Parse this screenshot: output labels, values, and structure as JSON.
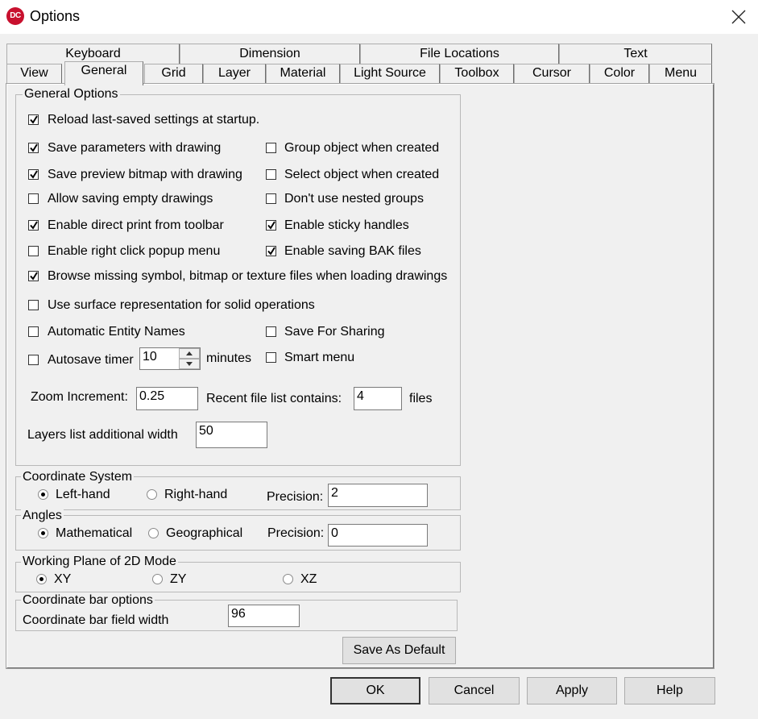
{
  "window": {
    "title": "Options",
    "icon_text": "DC"
  },
  "tabs": {
    "row1": [
      "Keyboard",
      "Dimension",
      "File Locations",
      "Text"
    ],
    "row2": [
      "View",
      "General",
      "Grid",
      "Layer",
      "Material",
      "Light Source",
      "Toolbox",
      "Cursor",
      "Color",
      "Menu"
    ],
    "selected": "General"
  },
  "general_options": {
    "legend": "General Options",
    "reload": {
      "label": "Reload last-saved settings at startup.",
      "checked": true
    },
    "save_params": {
      "label": "Save parameters with drawing",
      "checked": true
    },
    "group_object": {
      "label": "Group object when created",
      "checked": false
    },
    "save_preview": {
      "label": "Save preview bitmap with drawing",
      "checked": true
    },
    "select_object": {
      "label": "Select object when created",
      "checked": false
    },
    "allow_empty": {
      "label": "Allow saving empty drawings",
      "checked": false
    },
    "nested_groups": {
      "label": "Don't use nested groups",
      "checked": false
    },
    "direct_print": {
      "label": "Enable direct print from toolbar",
      "checked": true
    },
    "sticky_handles": {
      "label": "Enable sticky handles",
      "checked": true
    },
    "right_click": {
      "label": "Enable right click popup menu",
      "checked": false
    },
    "bak_files": {
      "label": "Enable saving BAK files",
      "checked": true
    },
    "browse_missing": {
      "label": "Browse missing symbol, bitmap or texture files when loading drawings",
      "checked": true
    },
    "surface_rep": {
      "label": "Use surface representation for solid operations",
      "checked": false
    },
    "auto_names": {
      "label": "Automatic Entity Names",
      "checked": false
    },
    "save_sharing": {
      "label": "Save For Sharing",
      "checked": false
    },
    "autosave": {
      "label": "Autosave timer",
      "checked": false,
      "value": "10",
      "unit": "minutes"
    },
    "smart_menu": {
      "label": "Smart menu",
      "checked": false
    },
    "zoom_increment": {
      "label": "Zoom Increment:",
      "value": "0.25"
    },
    "recent_files": {
      "label": "Recent file list contains:",
      "value": "4",
      "unit": "files"
    },
    "layers_width": {
      "label": "Layers list additional width",
      "value": "50"
    }
  },
  "coordinate_system": {
    "legend": "Coordinate System",
    "left_hand": "Left-hand",
    "right_hand": "Right-hand",
    "selected": "Left-hand",
    "precision_label": "Precision:",
    "precision": "2"
  },
  "angles": {
    "legend": "Angles",
    "mathematical": "Mathematical",
    "geographical": "Geographical",
    "selected": "Mathematical",
    "precision_label": "Precision:",
    "precision": "0"
  },
  "working_plane": {
    "legend": "Working Plane of 2D Mode",
    "xy": "XY",
    "zy": "ZY",
    "xz": "XZ",
    "selected": "XY"
  },
  "coord_bar": {
    "legend": "Coordinate bar options",
    "field_width_label": "Coordinate bar field width",
    "field_width": "96"
  },
  "buttons": {
    "save_default": "Save As Default",
    "ok": "OK",
    "cancel": "Cancel",
    "apply": "Apply",
    "help": "Help"
  }
}
